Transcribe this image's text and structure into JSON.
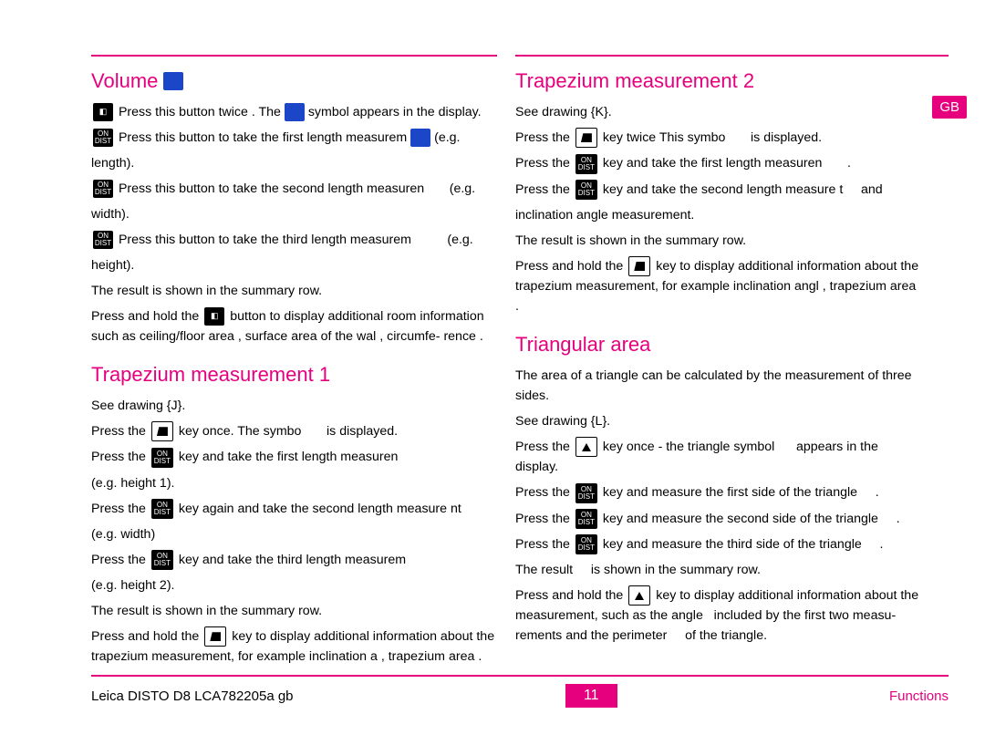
{
  "language_tab": "GB",
  "footer": {
    "left": "Leica DISTO  D8 LCA782205a gb",
    "page": "11",
    "right": "Functions"
  },
  "left_column": {
    "volume": {
      "title": "Volume",
      "l1a": "Press this button twice . The",
      "l1b": "symbol appears in the display.",
      "l2": "Press this button to take the first length measurem",
      "l2eg": "(e.g.",
      "l2tail": "length).",
      "l3": "Press this button to take the second length measuren",
      "l3eg": "(e.g.",
      "l3tail": "width).",
      "l4": "Press this button to take the third length measurem",
      "l4eg": "(e.g.",
      "l4tail": "height).",
      "result": "The result is shown in the summary row.",
      "hold1": "Press and hold  the",
      "hold2": "button to display additional room information",
      "hold3": "such as ceiling/floor area",
      "hold4": ", surface area of the wal",
      "hold5": ", circumfe-",
      "hold6": "rence",
      "hold7": "."
    },
    "trap1": {
      "title": "Trapezium measurement 1",
      "see": "See drawing {J}.",
      "p1a": "Press the",
      "p1b": "key once.  The symbo",
      "p1c": "is displayed.",
      "p2a": "Press the",
      "p2b": "key and take the first length measuren",
      "p2tail": "(e.g. height 1).",
      "p3a": "Press the",
      "p3b": "key again and take the second length measure         nt",
      "p3tail": "(e.g. width)",
      "p4a": "Press the",
      "p4b": "key and take the third length measurem",
      "p4tail": "(e.g. height 2).",
      "result": "The result is shown in the summary row.",
      "h1": "Press and hold  the",
      "h2": "key to display additional information about the",
      "h3": "trapezium measurement, for example inclination a",
      "h4": ", trapezium",
      "h5": "area",
      "h6": "."
    }
  },
  "right_column": {
    "trap2": {
      "title": "Trapezium measurement 2",
      "see": "See drawing {K}.",
      "p1a": "Press the",
      "p1b": "key twice This symbo",
      "p1c": "is displayed.",
      "p2a": "Press the",
      "p2b": "key and take the first length measuren",
      "p2c": ".",
      "p3a": "Press the",
      "p3b": "key and take the second length measure      t",
      "p3c": "and",
      "p3tail": "inclination angle measurement.",
      "result": "The result is shown in the summary row.",
      "h1": "Press and hold  the",
      "h2": "key to display additional information about the",
      "h3": "trapezium measurement, for exam­ple inclination angl",
      "h4": ", trapezium",
      "h5": "area",
      "h6": "."
    },
    "tri": {
      "title": "Triangular area",
      "intro": "The area of a triangle can be calculated by the measurement of three sides.",
      "see": "See drawing {L}.",
      "p1a": "Press the",
      "p1b": "key once - the triangle symbol",
      "p1c": "appears in the display.",
      "p2a": "Press the",
      "p2b": "key and measure the first side of the triangle",
      "p2c": ".",
      "p3a": "Press the",
      "p3b": "key and measure the second side of the triangle",
      "p3c": ".",
      "p4a": "Press the",
      "p4b": "key and measure the third side of the triangle",
      "p4c": ".",
      "result": "The result",
      "result2": "is shown in the summary row.",
      "h1": "Press and hold  the",
      "h2": "key to display additional information about the",
      "h3": "measurement, such as the angle",
      "h4": "included by the first two measu-",
      "h5": "rements and the perimeter",
      "h6": "of the triangle."
    }
  }
}
